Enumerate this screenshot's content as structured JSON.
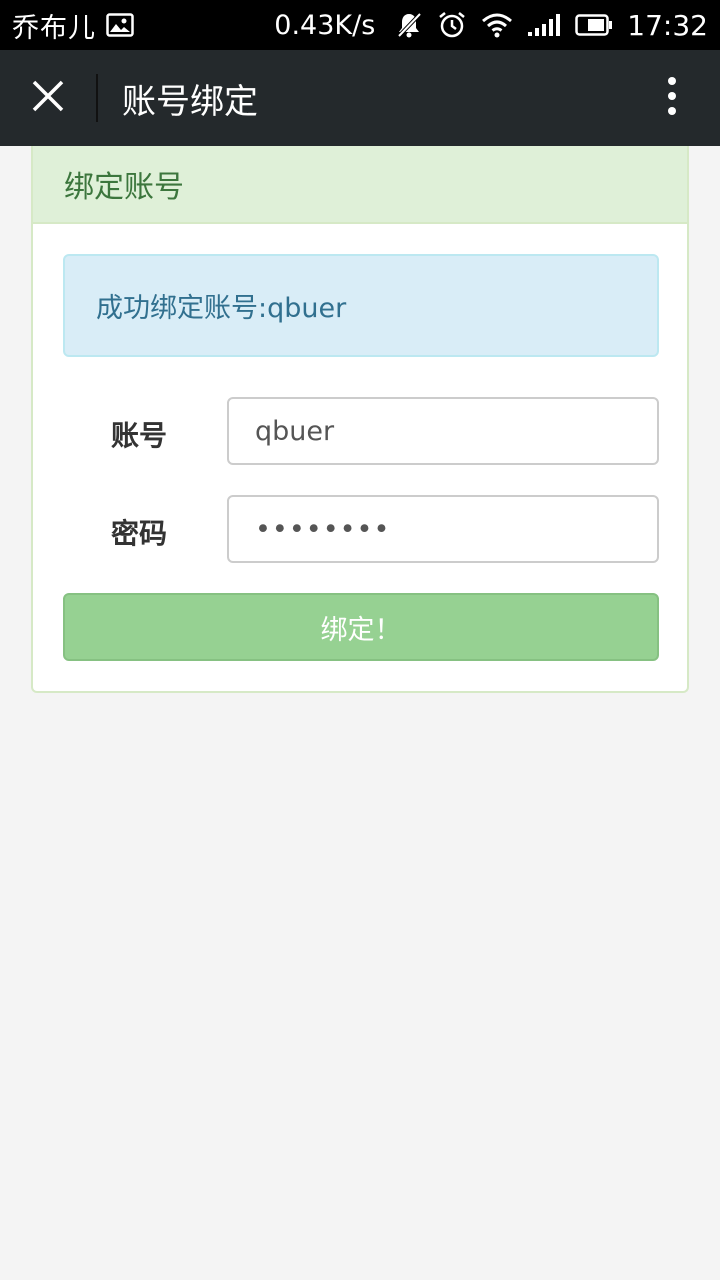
{
  "status_bar": {
    "carrier": "乔布儿",
    "speed": "0.43K/s",
    "time": "17:32"
  },
  "title_bar": {
    "title": "账号绑定"
  },
  "panel": {
    "heading": "绑定账号",
    "alert": "成功绑定账号:qbuer",
    "account_label": "账号",
    "account_value": "qbuer",
    "password_label": "密码",
    "password_value": "qbuer123",
    "submit_label": "绑定！"
  },
  "colors": {
    "title_bar_bg": "#24292c",
    "panel_heading_bg": "#dff0d8",
    "alert_bg": "#d9edf7",
    "button_bg": "#96d192"
  },
  "icons": [
    "close-icon",
    "more-vert-icon",
    "image-icon",
    "bell-muted-icon",
    "alarm-icon",
    "wifi-icon",
    "signal-icon",
    "battery-icon"
  ]
}
